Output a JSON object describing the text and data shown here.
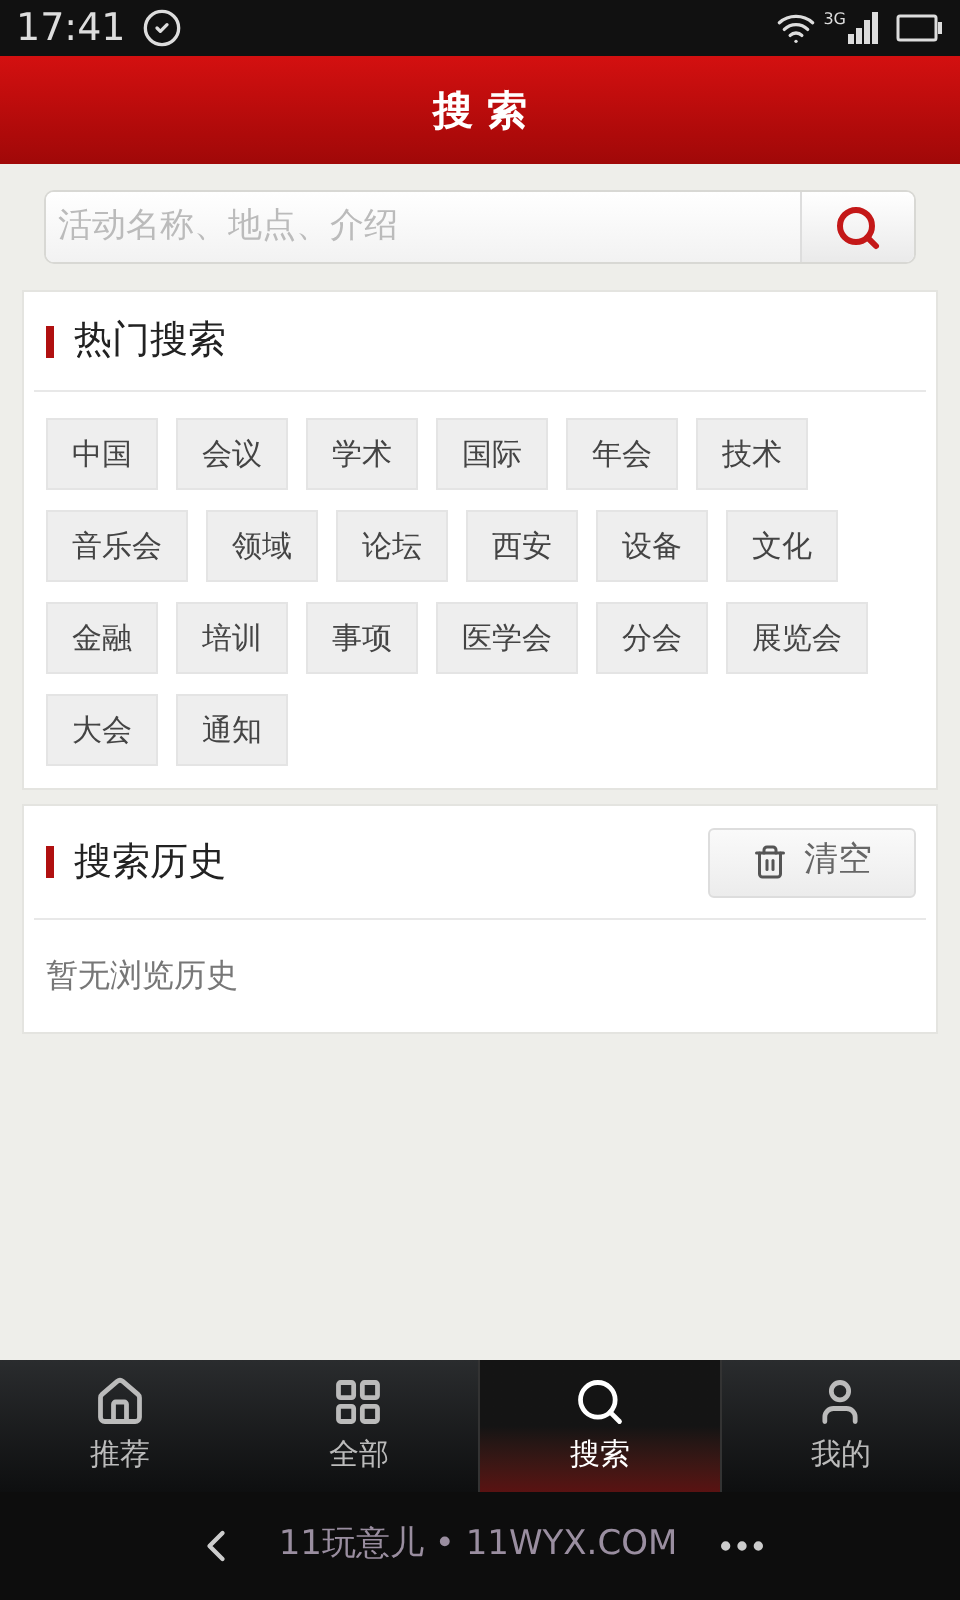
{
  "status_bar": {
    "time": "17:41",
    "network": "3G"
  },
  "header": {
    "title": "搜 索"
  },
  "search": {
    "placeholder": "活动名称、地点、介绍"
  },
  "hot": {
    "title": "热门搜索",
    "tags": [
      "中国",
      "会议",
      "学术",
      "国际",
      "年会",
      "技术",
      "音乐会",
      "领域",
      "论坛",
      "西安",
      "设备",
      "文化",
      "金融",
      "培训",
      "事项",
      "医学会",
      "分会",
      "展览会",
      "大会",
      "通知"
    ]
  },
  "history": {
    "title": "搜索历史",
    "clear_button": "清空",
    "empty_text": "暂无浏览历史"
  },
  "tabs": [
    {
      "label": "推荐",
      "kind": "home",
      "selected": false
    },
    {
      "label": "全部",
      "kind": "grid",
      "selected": false
    },
    {
      "label": "搜索",
      "kind": "search",
      "selected": true
    },
    {
      "label": "我的",
      "kind": "user",
      "selected": false
    }
  ],
  "browser_bar": {
    "title": "11玩意儿 • 11WYX.COM"
  }
}
